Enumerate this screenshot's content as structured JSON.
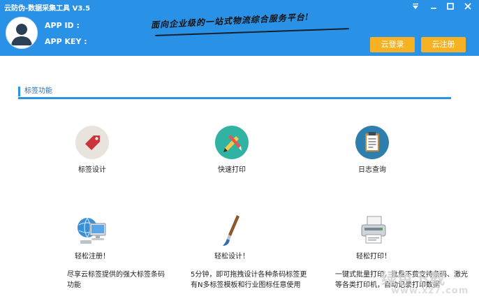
{
  "window": {
    "title": "云防伪-数据采集工具 V3.5"
  },
  "header": {
    "app_id_label": "APP  ID :",
    "app_key_label": "APP KEY :",
    "slogan": "面向企业级的一站式物流综合服务平台!",
    "login_button": "云登录",
    "register_button": "云注册",
    "background_color": "#2a92e6",
    "button_color": "#f6b222"
  },
  "section": {
    "title": "标签功能"
  },
  "features": [
    {
      "label": "标签设计",
      "icon": "tag-icon"
    },
    {
      "label": "快速打印",
      "icon": "pen-brush-icon"
    },
    {
      "label": "日志查询",
      "icon": "clipboard-icon"
    }
  ],
  "promos": [
    {
      "label": "轻松注册！",
      "icon": "computer-globe-icon",
      "description": "尽享云标签提供的强大标签条码功能"
    },
    {
      "label": "轻松设计！",
      "icon": "brush-icon",
      "description": "5分钟，即可拖拽设计各种条码标签更有N多标签模板和行业图标任意使用"
    },
    {
      "label": "轻松打印！",
      "icon": "printer-icon",
      "description": "一键式批量打印，批量不费支持条码、激光等各类打印机，自动记录打印数据"
    }
  ],
  "watermark": {
    "main": "绿色下载",
    "sub": "www.xz7.com"
  }
}
